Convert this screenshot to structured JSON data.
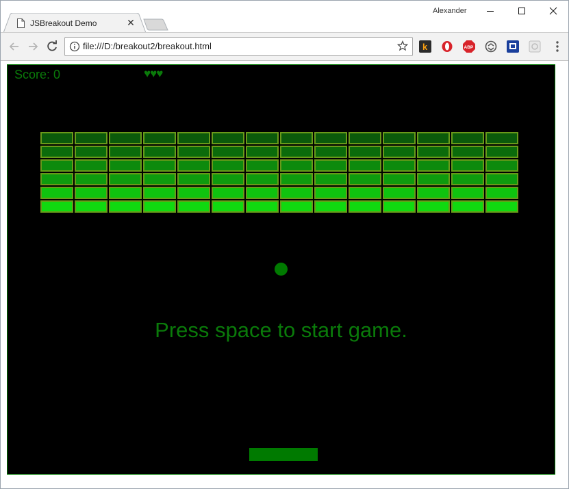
{
  "browser": {
    "tab_title": "JSBreakout Demo",
    "tab_close": "✕",
    "profile_name": "Alexander",
    "url": "file:///D:/breakout2/breakout.html",
    "extensions": [
      "k-extension-icon",
      "opera-icon",
      "adblock-abp-icon",
      "sync-icon",
      "translate-icon",
      "puzzle-icon"
    ]
  },
  "game": {
    "score_label": "Score: 0",
    "lives": "♥♥♥",
    "message": "Press space to start game.",
    "colors": {
      "background": "#000000",
      "text": "#0a7a0a",
      "ball": "#007a00",
      "paddle": "#007a00",
      "brick_border": "#6a9a1a"
    },
    "bricks": {
      "columns": 14,
      "rows": [
        {
          "color": "#0b5a0b"
        },
        {
          "color": "#0b6b0b"
        },
        {
          "color": "#0d8a0d"
        },
        {
          "color": "#0e9b0e"
        },
        {
          "color": "#0fc30f"
        },
        {
          "color": "#10d910"
        }
      ]
    }
  }
}
